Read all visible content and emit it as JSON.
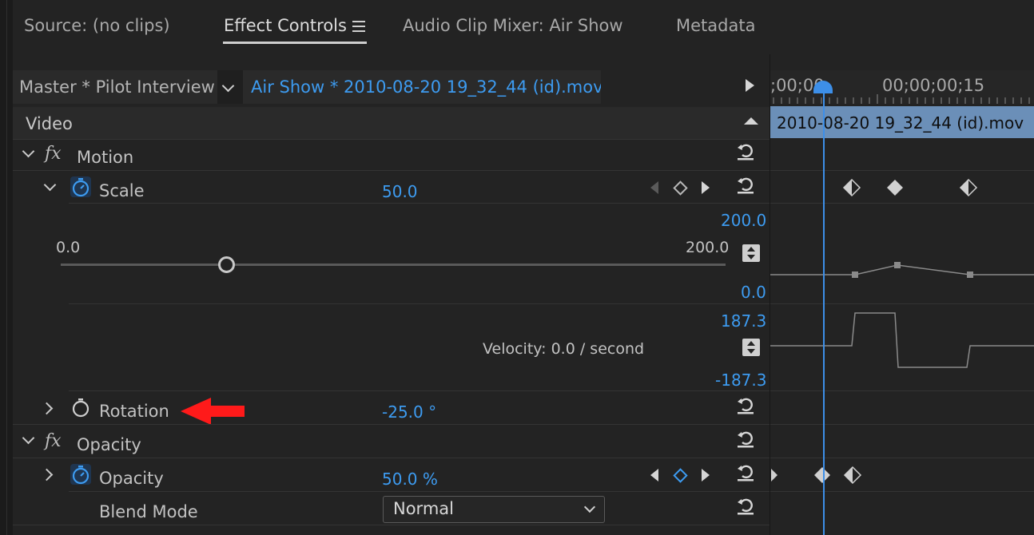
{
  "tabs": [
    {
      "label": "Source: (no clips)"
    },
    {
      "label": "Effect Controls"
    },
    {
      "label": "Audio Clip Mixer: Air Show"
    },
    {
      "label": "Metadata"
    }
  ],
  "clip_bar": {
    "master": "Master * Pilot Interview",
    "clip": "Air Show * 2010-08-20 19_32_44 (id).mov"
  },
  "section": {
    "video": "Video"
  },
  "motion": {
    "label": "Motion"
  },
  "scale": {
    "label": "Scale",
    "value": "50.0",
    "slider_min": "0.0",
    "slider_max": "200.0",
    "slider_fraction": 0.25,
    "graph_top": "200.0",
    "graph_bottom": "0.0",
    "vel_top": "187.3",
    "vel_bottom": "-187.3",
    "velocity": "Velocity: 0.0 / second"
  },
  "rotation": {
    "label": "Rotation",
    "value": "-25.0 °"
  },
  "opacity_group": {
    "label": "Opacity"
  },
  "opacity": {
    "label": "Opacity",
    "value": "50.0 %"
  },
  "blend": {
    "label": "Blend Mode",
    "value": "Normal"
  },
  "timeline": {
    "time_start": ";00;00",
    "time_mid": "00;00;00;15",
    "clip_label": "2010-08-20 19_32_44 (id).mov"
  },
  "colors": {
    "accent": "#3d9bf0",
    "arrow": "#ff1a1a",
    "clip": "#6b8fb8"
  }
}
